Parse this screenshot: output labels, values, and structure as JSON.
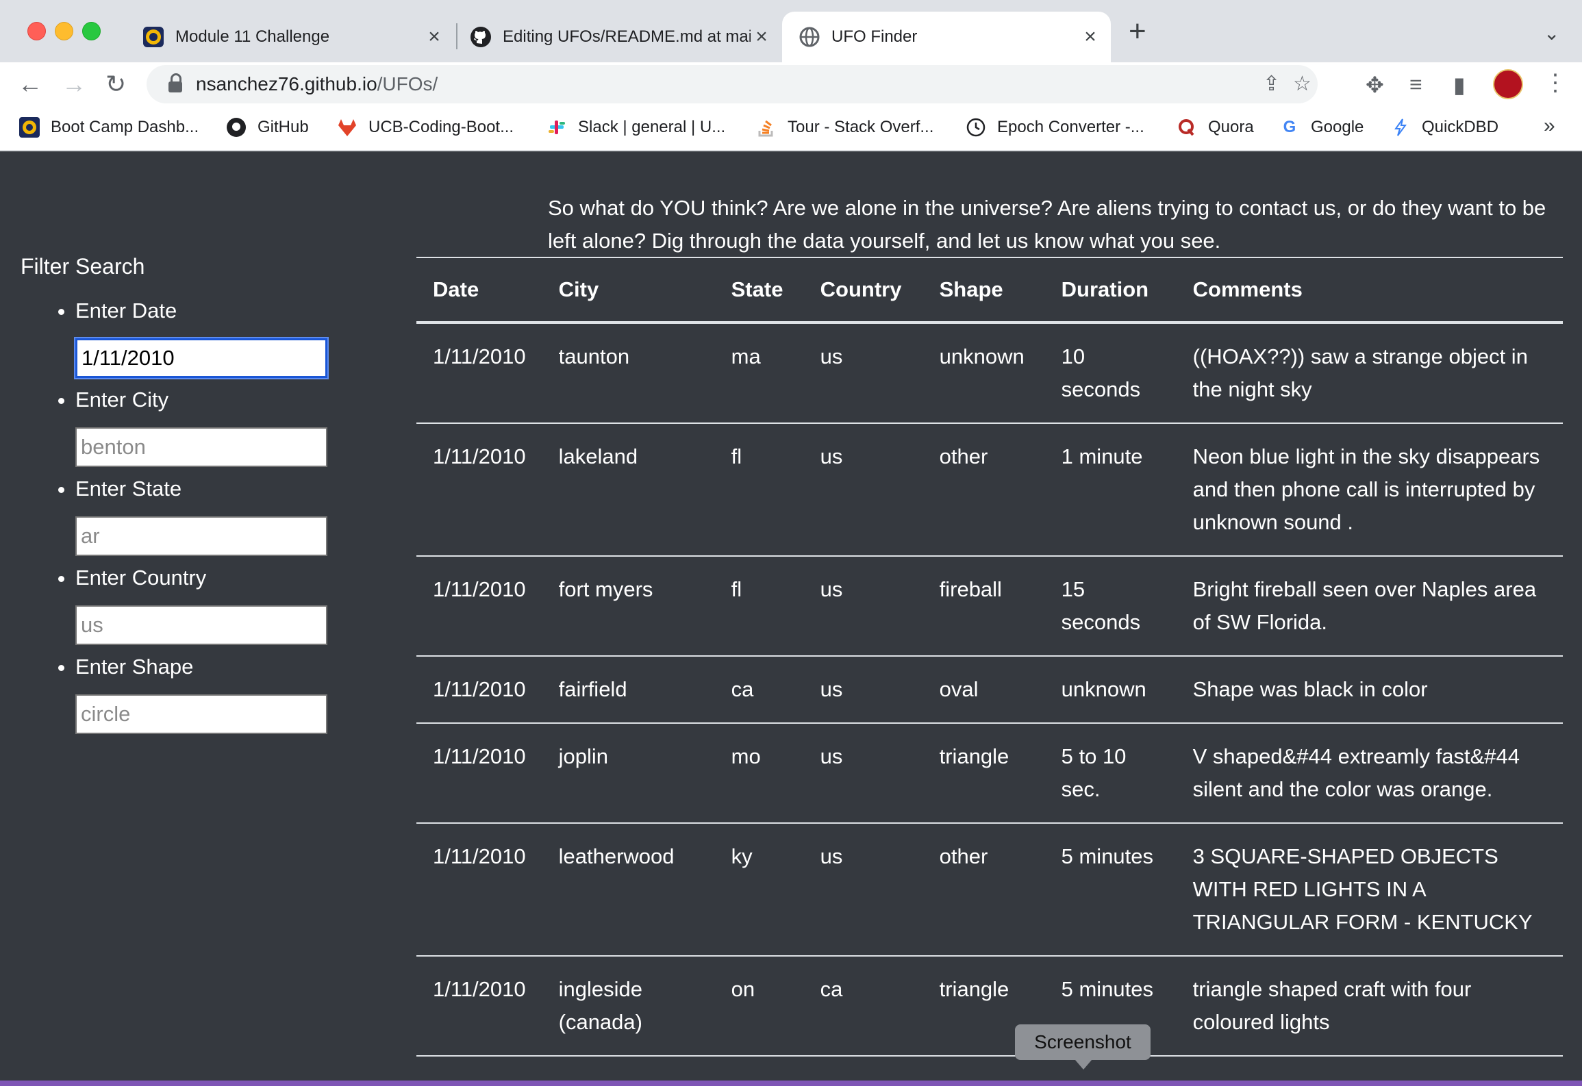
{
  "browser": {
    "tabs": [
      {
        "title": "Module 11 Challenge",
        "icon": "bootcamp-icon"
      },
      {
        "title": "Editing UFOs/README.md at main",
        "icon": "github-icon"
      },
      {
        "title": "UFO Finder",
        "icon": "globe-icon"
      }
    ],
    "url_host": "nsanchez76.github.io",
    "url_path": "/UFOs/",
    "bookmarks": [
      {
        "label": "Boot Camp Dashb...",
        "icon": "bootcamp-icon",
        "color": "#f2b705"
      },
      {
        "label": "GitHub",
        "icon": "github-icon",
        "color": "#24292e"
      },
      {
        "label": "UCB-Coding-Boot...",
        "icon": "gitlab-icon",
        "color": "#e24329"
      },
      {
        "label": "Slack | general | U...",
        "icon": "slack-icon",
        "color": "#4a154b"
      },
      {
        "label": "Tour - Stack Overf...",
        "icon": "stackoverflow-icon",
        "color": "#f48024"
      },
      {
        "label": "Epoch Converter -...",
        "icon": "clock-icon",
        "color": "#202124"
      },
      {
        "label": "Quora",
        "icon": "quora-icon",
        "color": "#b92b27"
      },
      {
        "label": "Google",
        "icon": "google-icon",
        "color": "#4285f4"
      },
      {
        "label": "QuickDBD",
        "icon": "bolt-icon",
        "color": "#3b82f6"
      }
    ]
  },
  "page": {
    "intro": "So what do YOU think? Are we alone in the universe? Are aliens trying to contact us, or do they want to be left alone? Dig through the data yourself, and let us know what you see.",
    "filter": {
      "title": "Filter Search",
      "fields": [
        {
          "label": "Enter Date",
          "value": "1/11/2010",
          "placeholder": ""
        },
        {
          "label": "Enter City",
          "value": "",
          "placeholder": "benton"
        },
        {
          "label": "Enter State",
          "value": "",
          "placeholder": "ar"
        },
        {
          "label": "Enter Country",
          "value": "",
          "placeholder": "us"
        },
        {
          "label": "Enter Shape",
          "value": "",
          "placeholder": "circle"
        }
      ]
    },
    "table": {
      "headers": [
        "Date",
        "City",
        "State",
        "Country",
        "Shape",
        "Duration",
        "Comments"
      ],
      "rows": [
        [
          "1/11/2010",
          "taunton",
          "ma",
          "us",
          "unknown",
          "10 seconds",
          "((HOAX??)) saw a strange object in the night sky"
        ],
        [
          "1/11/2010",
          "lakeland",
          "fl",
          "us",
          "other",
          "1 minute",
          "Neon blue light in the sky disappears and then phone call is interrupted by unknown sound ."
        ],
        [
          "1/11/2010",
          "fort myers",
          "fl",
          "us",
          "fireball",
          "15 seconds",
          "Bright fireball seen over Naples area of SW Florida."
        ],
        [
          "1/11/2010",
          "fairfield",
          "ca",
          "us",
          "oval",
          "unknown",
          "Shape was black in color"
        ],
        [
          "1/11/2010",
          "joplin",
          "mo",
          "us",
          "triangle",
          "5 to 10 sec.",
          "V shaped&#44 extreamly fast&#44 silent and the color was orange."
        ],
        [
          "1/11/2010",
          "leatherwood",
          "ky",
          "us",
          "other",
          "5 minutes",
          "3 SQUARE-SHAPED OBJECTS WITH RED LIGHTS IN A TRIANGULAR FORM - KENTUCKY"
        ],
        [
          "1/11/2010",
          "ingleside (canada)",
          "on",
          "ca",
          "triangle",
          "5 minutes",
          "triangle shaped craft with four coloured lights"
        ]
      ]
    },
    "tooltip": "Screenshot"
  }
}
